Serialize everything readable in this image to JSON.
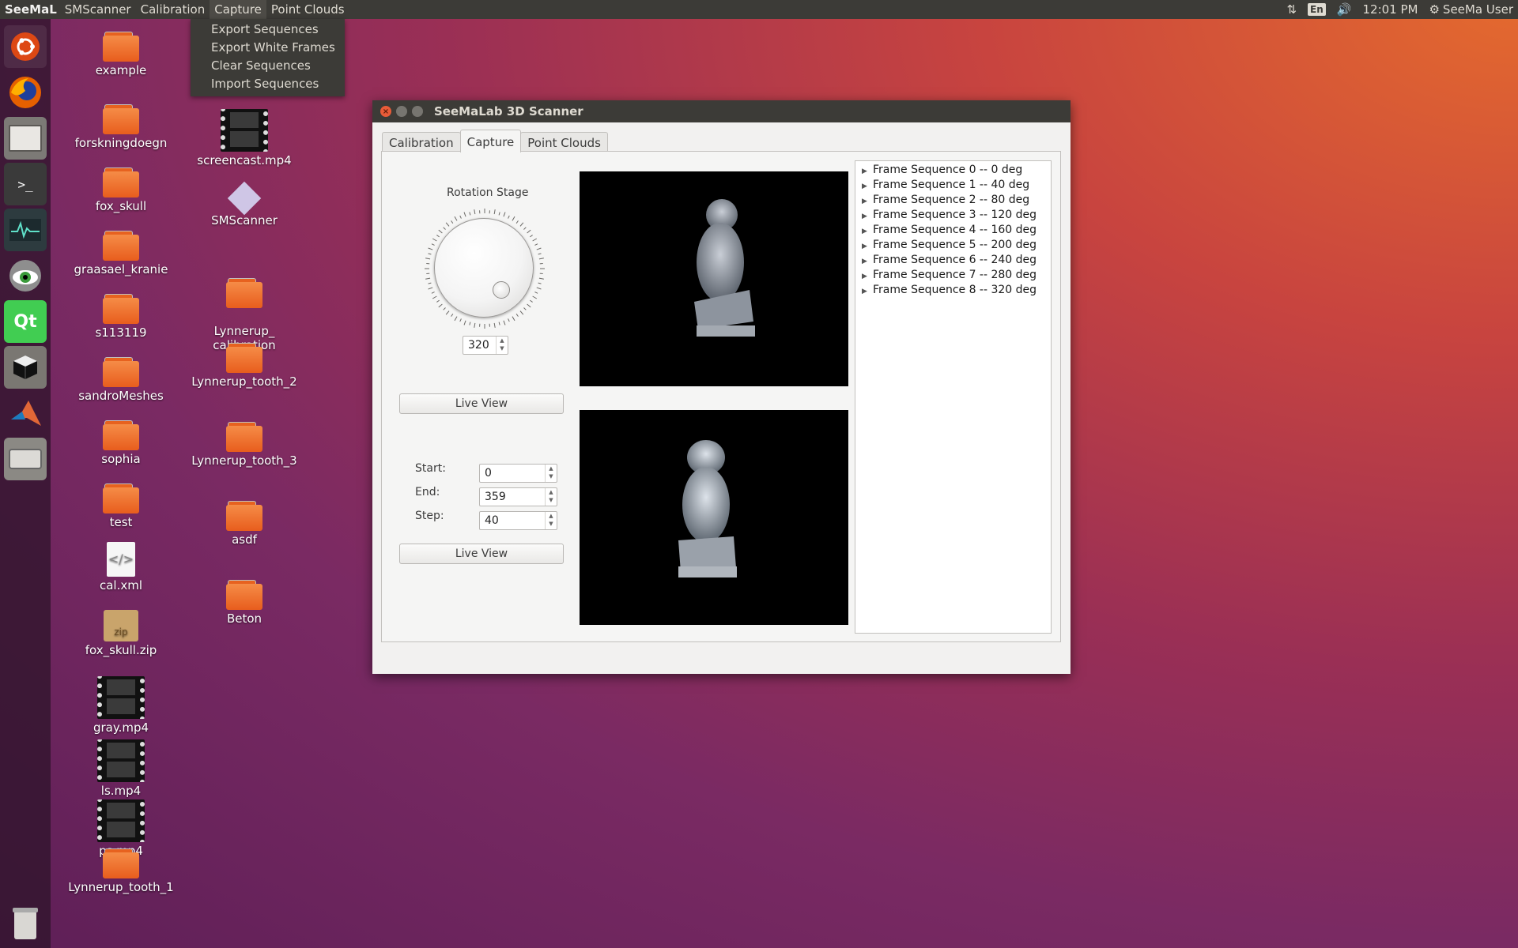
{
  "top_panel": {
    "app_name": "SeeMaL",
    "menus": [
      "SMScanner",
      "Calibration",
      "Capture",
      "Point Clouds"
    ],
    "lang": "En",
    "time": "12:01 PM",
    "user": "SeeMa User"
  },
  "capture_menu": {
    "items": [
      "Export Sequences",
      "Export White Frames",
      "Clear Sequences",
      "Import Sequences"
    ]
  },
  "desktop": {
    "col1": [
      "example",
      "forskningdoegn",
      "fox_skull",
      "graasael_kranie",
      "s113119",
      "sandroMeshes",
      "sophia",
      "test",
      "cal.xml",
      "fox_skull.zip",
      "gray.mp4",
      "ls.mp4",
      "ps.mp4",
      "Lynnerup_tooth_1"
    ],
    "col2": [
      "screencast.mp4",
      "SMScanner",
      "Lynnerup_\ncalibration",
      "Lynnerup_tooth_2",
      "Lynnerup_tooth_3",
      "asdf",
      "Beton"
    ],
    "zip_text": "zip",
    "xml_text": "</>"
  },
  "window": {
    "title": "SeeMaLab 3D Scanner",
    "tabs": [
      "Calibration",
      "Capture",
      "Point Clouds"
    ],
    "rotation_stage": "Rotation Stage",
    "angle": "320",
    "live_view": "Live View",
    "start_label": "Start:",
    "start_value": "0",
    "end_label": "End:",
    "end_value": "359",
    "step_label": "Step:",
    "step_value": "40",
    "live_view2": "Live View",
    "sequences": [
      "Frame Sequence 0 -- 0 deg",
      "Frame Sequence 1 -- 40 deg",
      "Frame Sequence 2 -- 80 deg",
      "Frame Sequence 3 -- 120 deg",
      "Frame Sequence 4 -- 160 deg",
      "Frame Sequence 5 -- 200 deg",
      "Frame Sequence 6 -- 240 deg",
      "Frame Sequence 7 -- 280 deg",
      "Frame Sequence 8 -- 320 deg"
    ]
  }
}
